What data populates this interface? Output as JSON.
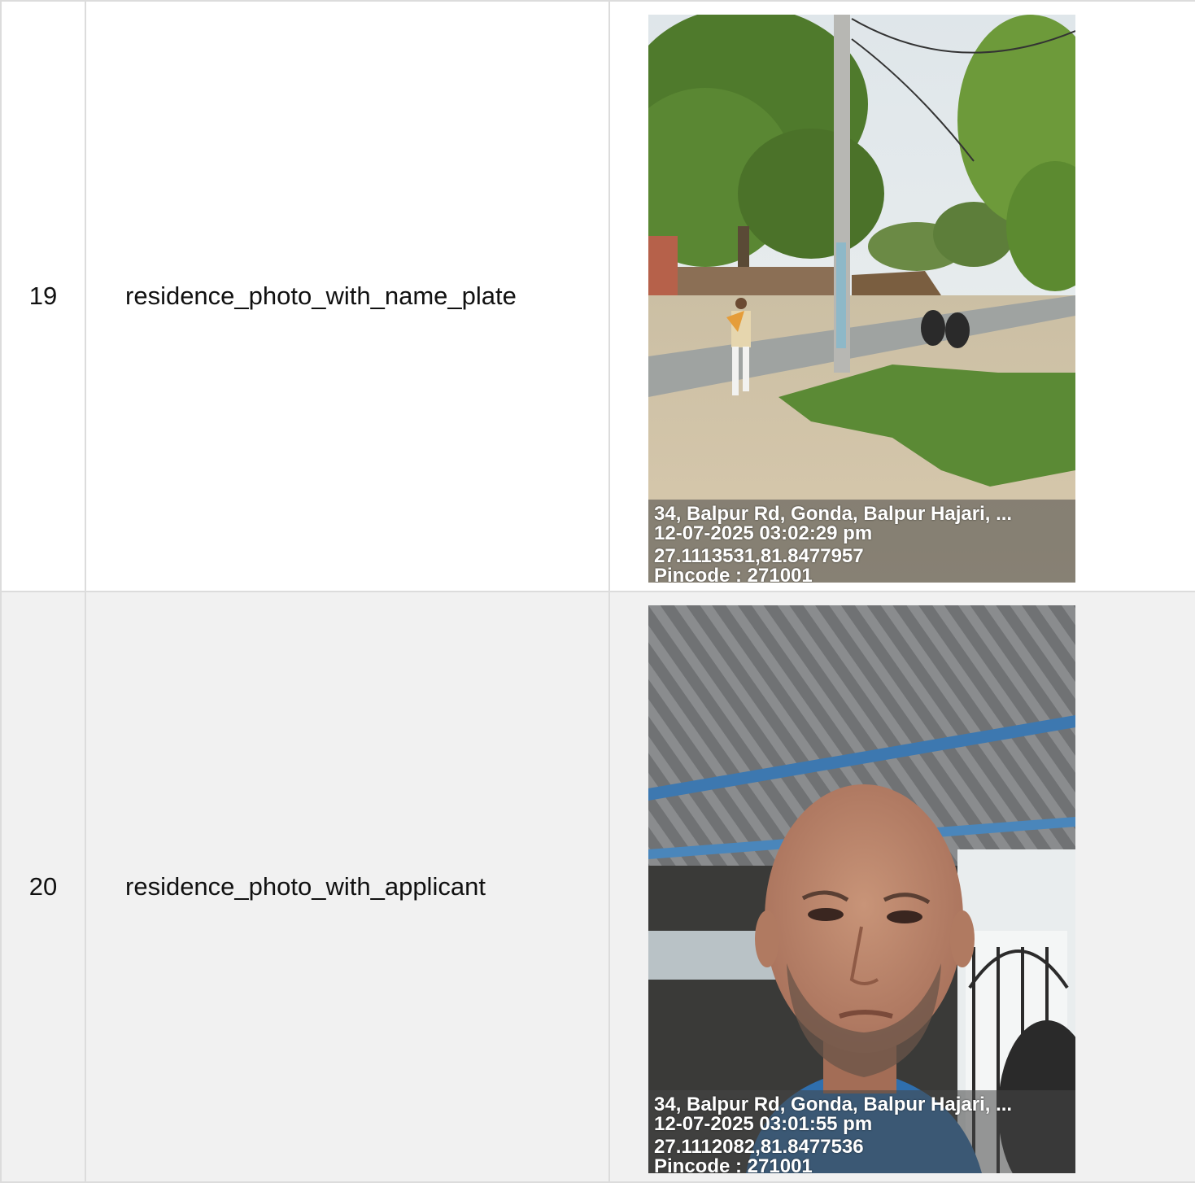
{
  "rows": [
    {
      "number": "19",
      "field": "residence_photo_with_name_plate",
      "photo": {
        "subject": "street scene with electric pole",
        "address": "34, Balpur Rd, Gonda, Balpur Hajari, ...",
        "datetime": "12-07-2025 03:02:29 pm",
        "coordinates": "27.1113531,81.8477957",
        "pincode": "Pincode : 271001"
      }
    },
    {
      "number": "20",
      "field": "residence_photo_with_applicant",
      "photo": {
        "subject": "selfie of applicant under tin roof",
        "address": "34, Balpur Rd, Gonda, Balpur Hajari, ...",
        "datetime": "12-07-2025 03:01:55 pm",
        "coordinates": "27.1112082,81.8477536",
        "pincode": "Pincode : 271001"
      }
    }
  ]
}
